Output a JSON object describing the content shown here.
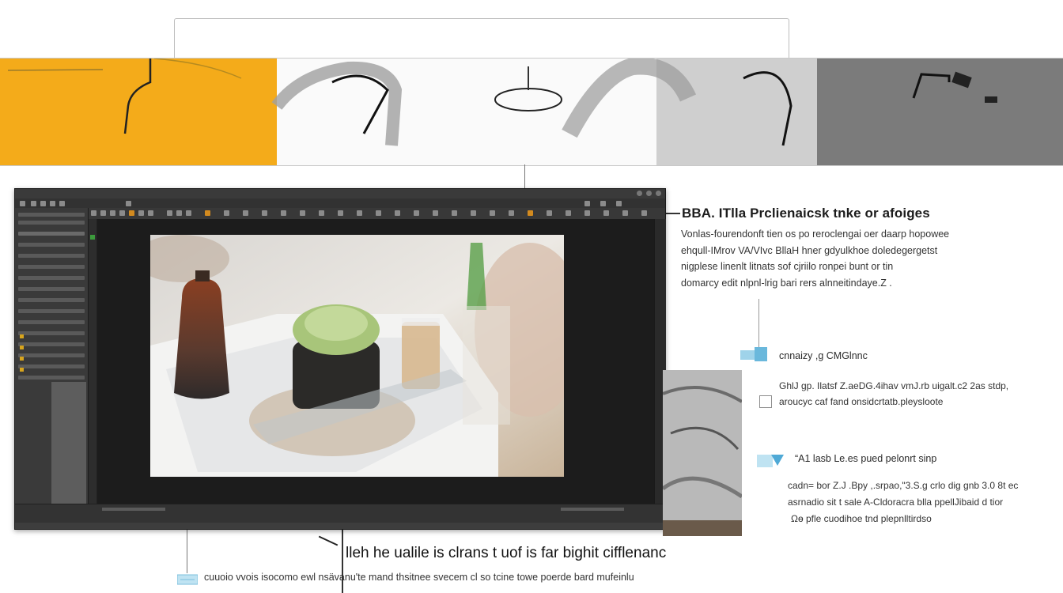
{
  "callout": {
    "title": "BBA. ITlla Prclienaicsk tnke or afoiges",
    "body": [
      "Vonlas-fourendonft tien os po reroclengai oer daarp hopowee",
      "ehqull-IMrov VA/VIvc BllaH hner gdyulkhoe doledegergetst",
      "nigplese linenlt litnats sof cjriilo ronpei bunt or tin",
      "domarcy edit nlpnl-lrig bari rers alnneitindaye.Z ."
    ]
  },
  "features": [
    {
      "label": "cnnaizy ,g CMGlnnc",
      "lines": [
        "GhlJ gp. Ilatsf Z.aeDG.4ihav vmJ.rb uigalt.c2 2as stdp,",
        "aroucyc caf fand onsidcrtatb.pleysloote"
      ],
      "checkbox_checked": false
    },
    {
      "label": "“A1 lasb Le.es pued pelonrt sinp",
      "lines": [
        "cadn= bor Z.J .Bpy ,.srpao,\"3.S.g crlo dig gnb 3.0 8t ec",
        "asrnadio sit t sale A-Cldoracra blla ppellJibaid d tior",
        "Ωɵ pfle cuodihoe tnd plepnlltirdso"
      ]
    }
  ],
  "bottom": {
    "heading": "lleh he ualile is clrans t uof is far bighit cifflenanc",
    "text": "cuuoio vvois isocomo ewl  nsävanu'te mand thsitnee svecem cl so tcine towe poerde bard mufeinlu"
  },
  "colors": {
    "strip_yellow": "#f4ab1a",
    "editor_bg": "#2b2b2b",
    "canvas_bg": "#1c1c1c"
  }
}
